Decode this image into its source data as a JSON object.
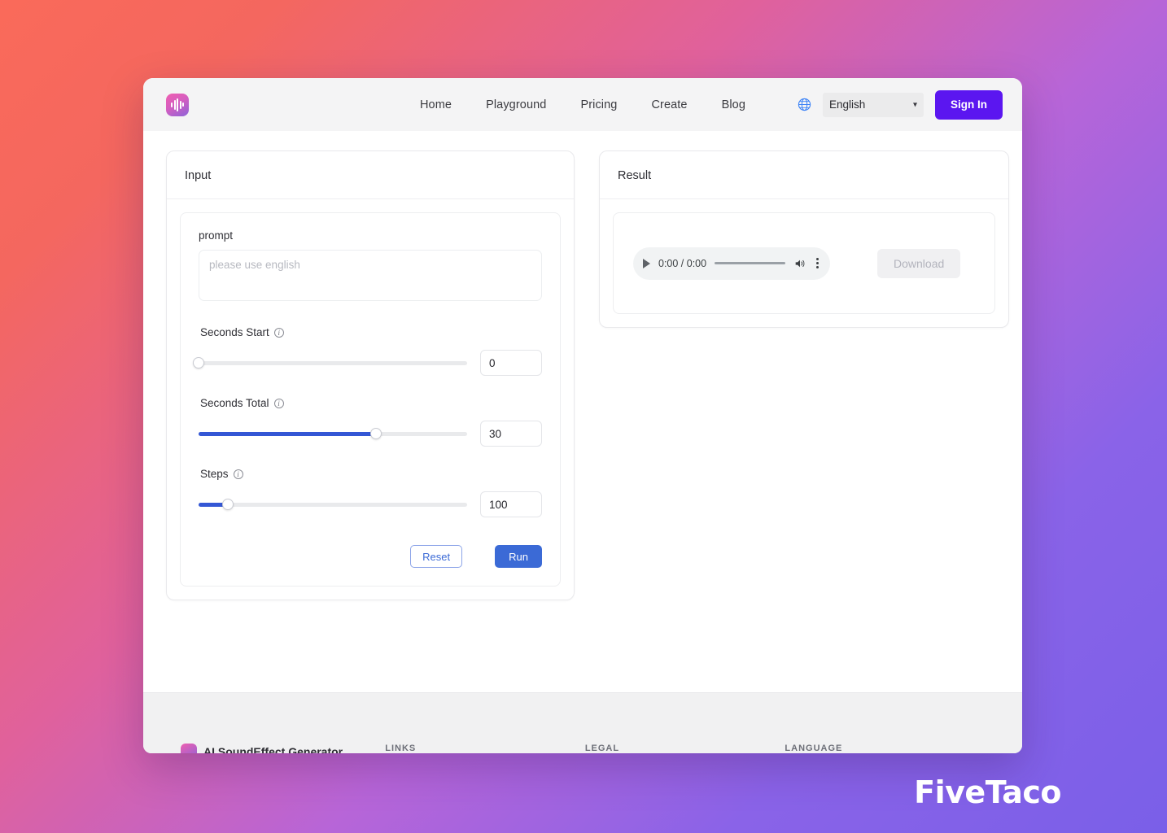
{
  "nav": {
    "logo_icon": "audio-waveform-logo",
    "links": [
      {
        "label": "Home"
      },
      {
        "label": "Playground"
      },
      {
        "label": "Pricing"
      },
      {
        "label": "Create"
      },
      {
        "label": "Blog"
      }
    ],
    "globe_icon": "globe-icon",
    "language_selected": "English",
    "language_options": [
      "English"
    ],
    "chevron": "▾",
    "signin_label": "Sign In"
  },
  "input_panel": {
    "title": "Input",
    "prompt_label": "prompt",
    "prompt_value": "",
    "prompt_placeholder": "please use english",
    "sliders": [
      {
        "label": "Seconds Start",
        "info_glyph": "i",
        "value": "0",
        "percent": 0
      },
      {
        "label": "Seconds Total",
        "info_glyph": "i",
        "value": "30",
        "percent": 66
      },
      {
        "label": "Steps",
        "info_glyph": "i",
        "value": "100",
        "percent": 11
      }
    ],
    "reset_label": "Reset",
    "run_label": "Run"
  },
  "result_panel": {
    "title": "Result",
    "player": {
      "play_icon": "play-icon",
      "time": "0:00 / 0:00",
      "volume_icon": "volume-icon",
      "menu_icon": "kebab-menu-icon"
    },
    "download_label": "Download"
  },
  "footer": {
    "brand_name": "AI SoundEffect Generator",
    "columns": [
      {
        "heading": "LINKS"
      },
      {
        "heading": "LEGAL"
      },
      {
        "heading": "LANGUAGE"
      }
    ]
  },
  "watermark": {
    "text": "FiveTaco"
  },
  "colors": {
    "accent_purple": "#5b16f0",
    "accent_blue": "#3457d5",
    "button_blue": "#3b6ad6",
    "topbar_bg": "#f4f4f5",
    "footer_bg": "#f1f1f2"
  }
}
